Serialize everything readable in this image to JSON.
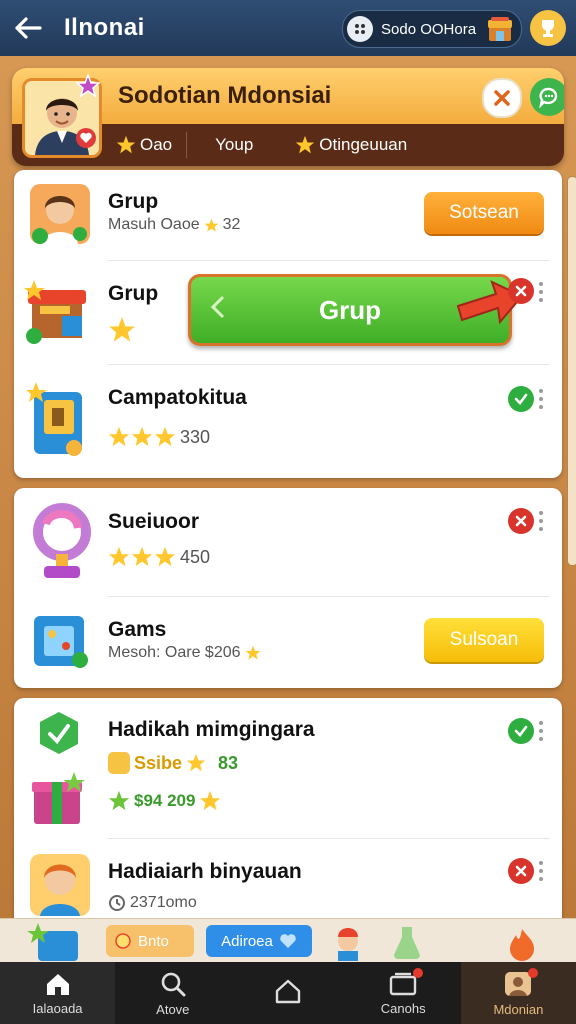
{
  "topbar": {
    "title": "Ilnonai",
    "pill_label": "Sodo OOHora"
  },
  "header": {
    "title": "Sodotian Mdonsiai",
    "tabs": [
      {
        "label": "Oao",
        "star": true
      },
      {
        "label": "Youp",
        "star": false
      },
      {
        "label": "Otingeuuan",
        "star": true
      }
    ]
  },
  "cards": [
    {
      "rows": [
        {
          "title": "Grup",
          "sub": "Masuh Oaoe",
          "sub_value": "32",
          "action": "Sotsean"
        },
        {
          "title": "Grup",
          "green_button": "Grup"
        },
        {
          "title": "Campatokitua",
          "rating_text": "330",
          "stars": 3,
          "status": "ok"
        }
      ]
    },
    {
      "rows": [
        {
          "title": "Sueiuoor",
          "rating_text": "450",
          "stars": 3,
          "status": "no"
        },
        {
          "title": "Gams",
          "sub": "Mesoh: Oare $206",
          "action": "Sulsoan"
        }
      ]
    },
    {
      "rows": [
        {
          "title": "Hadikah mimgingara",
          "line1": "Ssibe",
          "line1_value": "83",
          "line2": "$94 209",
          "status": "ok"
        },
        {
          "title": "Hadiaiarh binyauan",
          "sub": "2371omo",
          "status": "no"
        }
      ]
    }
  ],
  "shelf": {
    "chip1": "Bnto",
    "chip2": "Adiroea"
  },
  "nav": [
    {
      "label": "Ialaoada",
      "icon": "home-icon"
    },
    {
      "label": "Atove",
      "icon": "search-icon"
    },
    {
      "label": "",
      "icon": "house-outline-icon"
    },
    {
      "label": "Canohs",
      "icon": "cards-icon"
    },
    {
      "label": "Mdonian",
      "icon": "profile-icon"
    }
  ],
  "colors": {
    "topbar": "#2f4d73",
    "header_gold": "#f4ac3e",
    "header_dark": "#5a2c17",
    "action_orange": "#f08a13",
    "action_yellow": "#f6bd08",
    "action_green": "#3fae27",
    "ok": "#2eae3f",
    "no": "#d9342b"
  }
}
